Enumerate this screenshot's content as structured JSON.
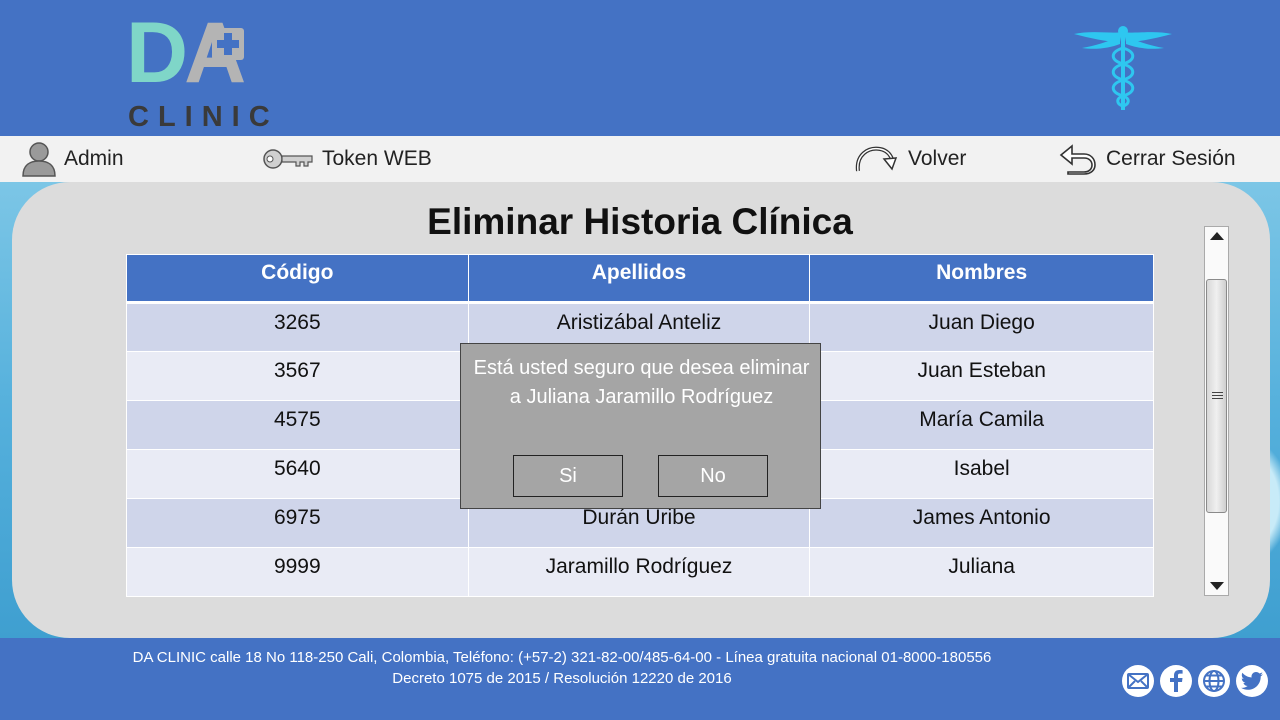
{
  "header": {
    "logo_text_da": "DA",
    "logo_text_clinic": "CLINIC",
    "logo_icon": "medical-cross-icon",
    "emblem_icon": "caduceus-icon"
  },
  "nav": {
    "admin_label": "Admin",
    "token_label": "Token WEB",
    "back_label": "Volver",
    "logout_label": "Cerrar Sesión"
  },
  "page": {
    "title": "Eliminar Historia Clínica"
  },
  "table": {
    "columns": [
      "Código",
      "Apellidos",
      "Nombres"
    ],
    "rows": [
      [
        "3265",
        "Aristizábal Anteliz",
        "Juan Diego"
      ],
      [
        "3567",
        "",
        "Juan Esteban"
      ],
      [
        "4575",
        "",
        "María Camila"
      ],
      [
        "5640",
        "",
        "Isabel"
      ],
      [
        "6975",
        "Durán Uribe",
        "James Antonio"
      ],
      [
        "9999",
        "Jaramillo Rodríguez",
        "Juliana"
      ]
    ]
  },
  "dialog": {
    "message": "Está usted seguro que desea eliminar a Juliana Jaramillo Rodríguez",
    "yes_label": "Si",
    "no_label": "No"
  },
  "footer": {
    "line1": "DA CLINIC calle 18 No 118-250 Cali, Colombia, Teléfono: (+57-2) 321-82-00/485-64-00 - Línea gratuita nacional 01-8000-180556",
    "line2": "Decreto 1075 de 2015 / Resolución 12220 de 2016",
    "social": [
      "mail-icon",
      "facebook-icon",
      "web-icon",
      "twitter-icon"
    ]
  },
  "colors": {
    "brand_blue": "#4472c4",
    "row_odd": "#cfd5ea",
    "row_even": "#e9ebf5",
    "dialog_bg": "#a5a5a5",
    "logo_teal": "#7fd6c8",
    "caduceus": "#2ec7f0"
  }
}
